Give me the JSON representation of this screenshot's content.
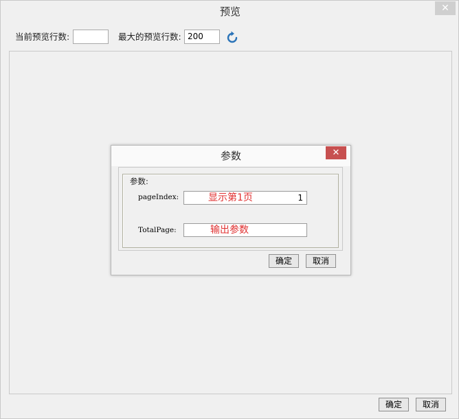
{
  "window": {
    "title": "预览",
    "close_glyph": "✕"
  },
  "toolbar": {
    "current_rows_label": "当前预览行数:",
    "current_rows_value": "",
    "max_rows_label": "最大的预览行数:",
    "max_rows_value": "200",
    "refresh_icon": "refresh-icon",
    "refresh_color": "#2a73b8"
  },
  "dialog": {
    "title": "参数",
    "close_glyph": "✕",
    "close_color": "#c75050",
    "group_label": "参数:",
    "params": [
      {
        "label": "pageIndex:",
        "description": "显示第1页",
        "value": "1"
      },
      {
        "label": "TotalPage:",
        "description": "输出参数",
        "value": ""
      }
    ],
    "ok_label": "确定",
    "cancel_label": "取消"
  },
  "footer": {
    "ok_label": "确定",
    "cancel_label": "取消"
  }
}
